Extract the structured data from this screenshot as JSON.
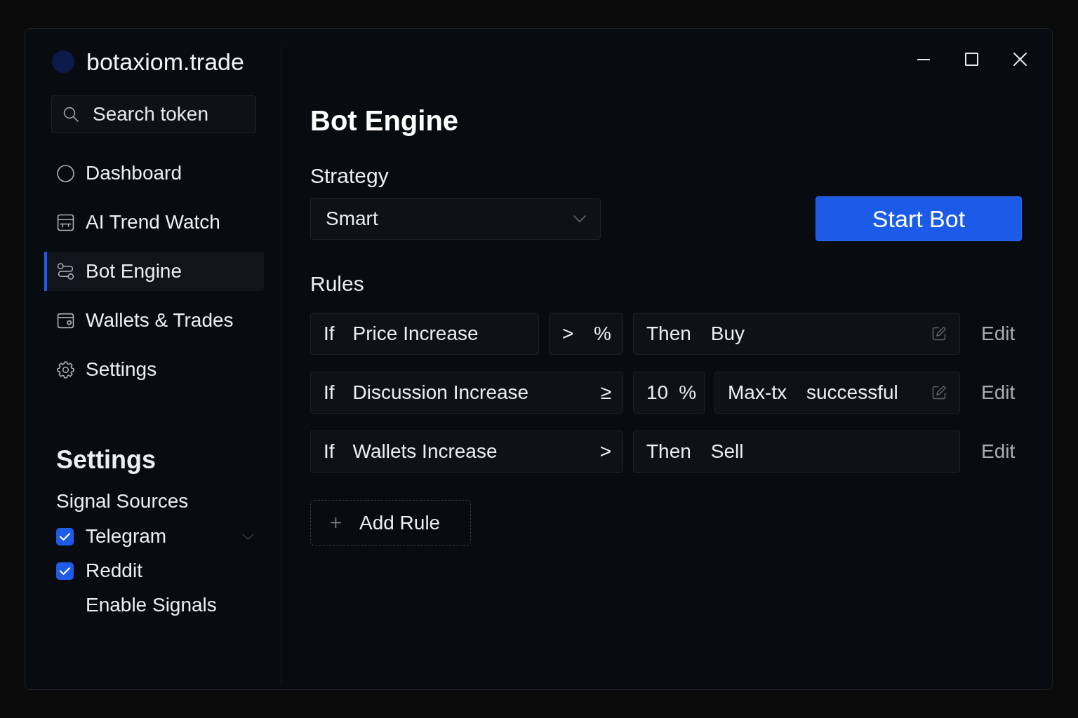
{
  "sidebar": {
    "brand": "botaxiom.trade",
    "search": {
      "placeholder": "Search token"
    },
    "nav_items": [
      {
        "label": "Dashboard",
        "selected": false
      },
      {
        "label": "AI Trend Watch",
        "selected": false
      },
      {
        "label": "Bot Engine",
        "selected": true
      },
      {
        "label": "Wallets & Trades",
        "selected": false
      },
      {
        "label": "Settings",
        "selected": false
      }
    ],
    "settings": {
      "title": "Settings",
      "subtitle": "Signal Sources",
      "sources": [
        {
          "label": "Telegram",
          "checked": true,
          "dropdown": true
        },
        {
          "label": "Reddit",
          "checked": true,
          "dropdown": false
        }
      ],
      "option_label": "Enable Signals"
    }
  },
  "main": {
    "title": "Bot Engine",
    "strategy": {
      "label": "Strategy",
      "value": "Smart"
    },
    "start_button": "Start Bot",
    "rules_title": "Rules",
    "rules": [
      {
        "cells": [
          {
            "kind": "condition",
            "parts": [
              "If",
              "Price Increase"
            ]
          },
          {
            "kind": "operator",
            "parts": [
              ">"
            ],
            "end": "%"
          },
          {
            "kind": "action",
            "parts": [
              "Then",
              "Buy"
            ],
            "editable": true
          }
        ],
        "edit": "Edit"
      },
      {
        "cells": [
          {
            "kind": "condition",
            "parts": [
              "If",
              "Discussion Increase"
            ],
            "end": "≥"
          },
          {
            "kind": "value",
            "parts": [
              "10",
              "%"
            ]
          },
          {
            "kind": "action",
            "parts": [
              "Max-tx",
              "successful"
            ],
            "editable": true
          }
        ],
        "edit": "Edit"
      },
      {
        "cells": [
          {
            "kind": "condition",
            "parts": [
              "If",
              "Wallets Increase"
            ],
            "end": ">"
          },
          {
            "kind": "action",
            "parts": [
              "Then",
              "Sell"
            ],
            "editable": false
          }
        ],
        "edit": "Edit"
      }
    ],
    "add_rule_button": "Add Rule"
  }
}
